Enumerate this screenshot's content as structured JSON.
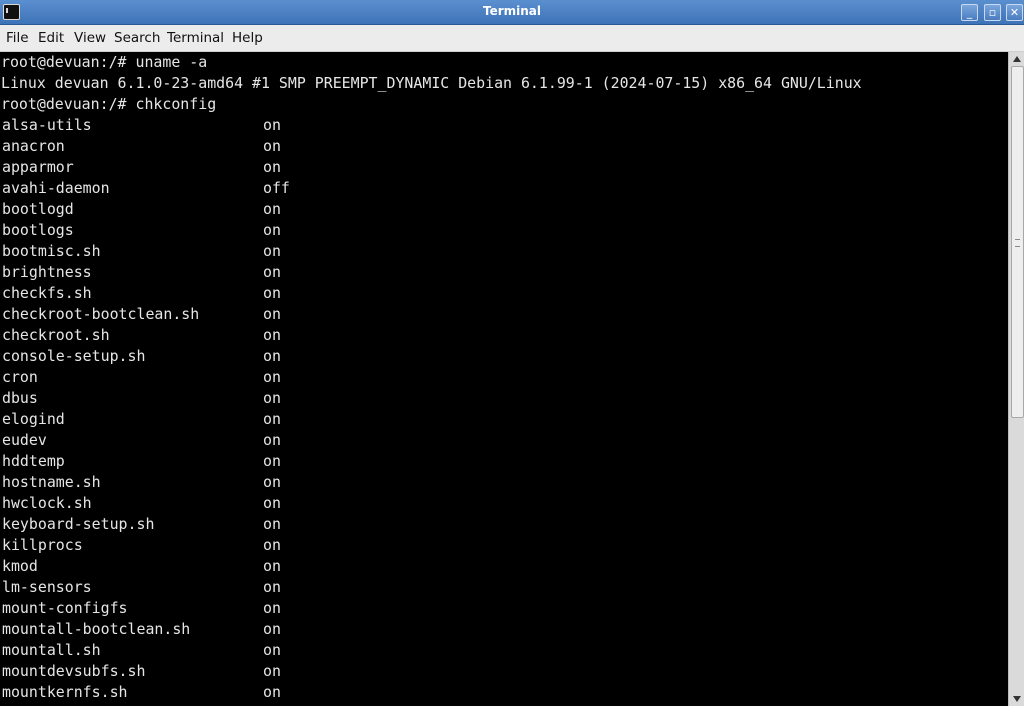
{
  "window": {
    "title": "Terminal"
  },
  "menu": [
    "File",
    "Edit",
    "View",
    "Search",
    "Terminal",
    "Help"
  ],
  "terminal": {
    "prompt1": "root@devuan:/# uname -a",
    "uname_output": "Linux devuan 6.1.0-23-amd64 #1 SMP PREEMPT_DYNAMIC Debian 6.1.99-1 (2024-07-15) x86_64 GNU/Linux",
    "prompt2": "root@devuan:/# chkconfig",
    "services": [
      {
        "name": "alsa-utils",
        "state": "on"
      },
      {
        "name": "anacron",
        "state": "on"
      },
      {
        "name": "apparmor",
        "state": "on"
      },
      {
        "name": "avahi-daemon",
        "state": "off"
      },
      {
        "name": "bootlogd",
        "state": "on"
      },
      {
        "name": "bootlogs",
        "state": "on"
      },
      {
        "name": "bootmisc.sh",
        "state": "on"
      },
      {
        "name": "brightness",
        "state": "on"
      },
      {
        "name": "checkfs.sh",
        "state": "on"
      },
      {
        "name": "checkroot-bootclean.sh",
        "state": "on"
      },
      {
        "name": "checkroot.sh",
        "state": "on"
      },
      {
        "name": "console-setup.sh",
        "state": "on"
      },
      {
        "name": "cron",
        "state": "on"
      },
      {
        "name": "dbus",
        "state": "on"
      },
      {
        "name": "elogind",
        "state": "on"
      },
      {
        "name": "eudev",
        "state": "on"
      },
      {
        "name": "hddtemp",
        "state": "on"
      },
      {
        "name": "hostname.sh",
        "state": "on"
      },
      {
        "name": "hwclock.sh",
        "state": "on"
      },
      {
        "name": "keyboard-setup.sh",
        "state": "on"
      },
      {
        "name": "killprocs",
        "state": "on"
      },
      {
        "name": "kmod",
        "state": "on"
      },
      {
        "name": "lm-sensors",
        "state": "on"
      },
      {
        "name": "mount-configfs",
        "state": "on"
      },
      {
        "name": "mountall-bootclean.sh",
        "state": "on"
      },
      {
        "name": "mountall.sh",
        "state": "on"
      },
      {
        "name": "mountdevsubfs.sh",
        "state": "on"
      },
      {
        "name": "mountkernfs.sh",
        "state": "on"
      }
    ]
  },
  "icons": {
    "app": "terminal-icon",
    "minimize": "minimize-icon",
    "maximize": "maximize-icon",
    "close": "close-icon"
  }
}
